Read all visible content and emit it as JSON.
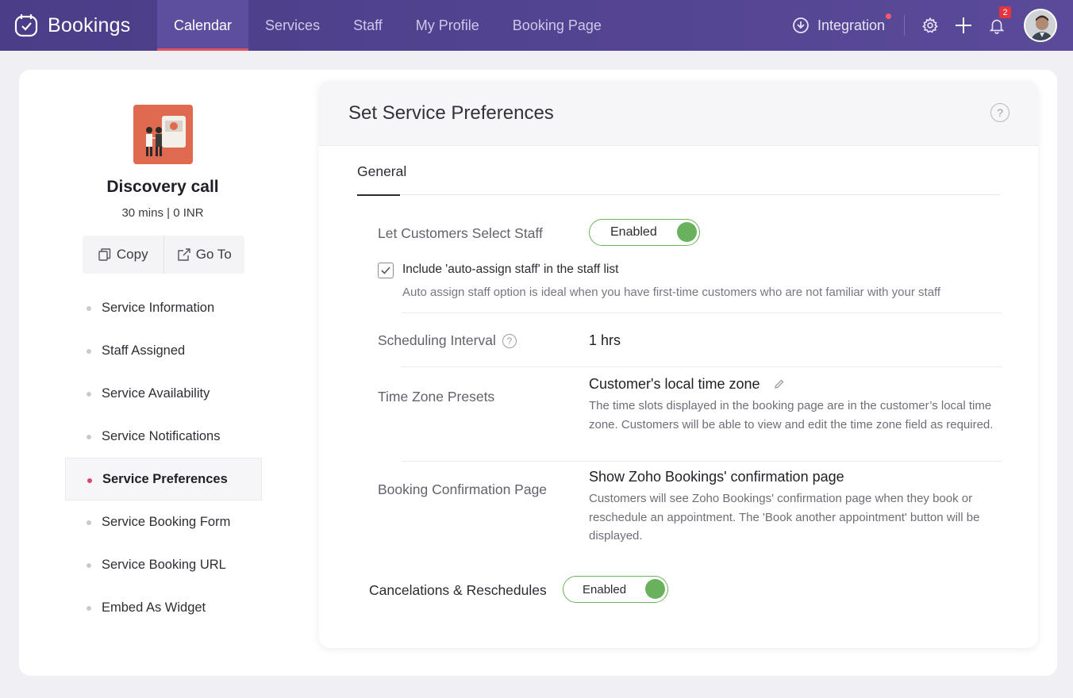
{
  "app": {
    "name": "Bookings"
  },
  "nav": {
    "items": [
      {
        "label": "Calendar",
        "active": true
      },
      {
        "label": "Services"
      },
      {
        "label": "Staff"
      },
      {
        "label": "My Profile"
      },
      {
        "label": "Booking Page"
      }
    ],
    "integration_label": "Integration",
    "notification_count": "2"
  },
  "service": {
    "title": "Discovery call",
    "subtitle": "30 mins | 0 INR",
    "copy_label": "Copy",
    "goto_label": "Go To"
  },
  "sidebar": {
    "items": [
      {
        "label": "Service Information"
      },
      {
        "label": "Staff Assigned"
      },
      {
        "label": "Service Availability"
      },
      {
        "label": "Service Notifications"
      },
      {
        "label": "Service Preferences",
        "active": true
      },
      {
        "label": "Service Booking Form"
      },
      {
        "label": "Service Booking URL"
      },
      {
        "label": "Embed As Widget"
      }
    ]
  },
  "panel": {
    "title": "Set Service Preferences",
    "help_symbol": "?",
    "tab_general": "General",
    "select_staff": {
      "label": "Let Customers Select Staff",
      "toggle": "Enabled"
    },
    "auto_assign": {
      "label": "Include 'auto-assign staff' in the staff list",
      "hint": "Auto assign staff option is ideal when you have first-time customers who are not familiar with your staff",
      "checked": true
    },
    "scheduling": {
      "label": "Scheduling Interval",
      "value": "1 hrs"
    },
    "timezone": {
      "label": "Time Zone Presets",
      "value": "Customer's local time zone",
      "desc": "The time slots displayed in the booking page are in the customer’s local time zone. Customers will be able to view and edit the time zone field as required."
    },
    "confirmation": {
      "label": "Booking Confirmation Page",
      "value": "Show Zoho Bookings' confirmation page",
      "desc": "Customers will see Zoho Bookings' confirmation page when they book or reschedule an appointment. The 'Book another appointment' button will be displayed."
    },
    "cancel": {
      "label": "Cancelations & Reschedules",
      "toggle": "Enabled"
    }
  },
  "colors": {
    "topbar": "#4b3d88",
    "accent": "#e0545f",
    "toggle_on": "#6ab15e"
  }
}
